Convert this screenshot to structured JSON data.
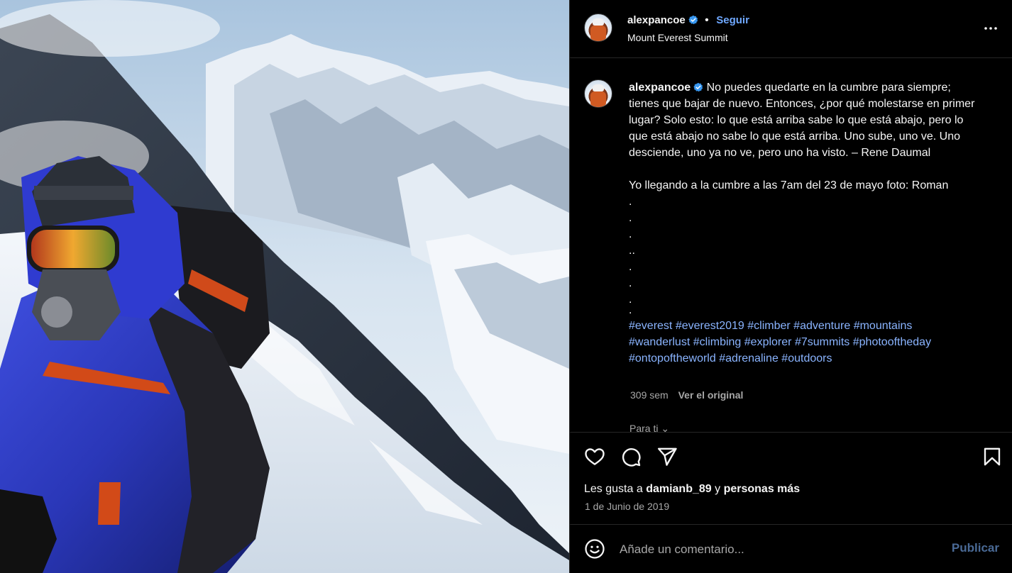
{
  "post": {
    "photo_alt": "Climber on Mount Everest summit ridge",
    "account": {
      "username": "alexpancoe",
      "verified": true,
      "follow_label": "Seguir",
      "location": "Mount Everest Summit"
    },
    "caption": {
      "username": "alexpancoe",
      "text_lines": [
        "No puedes quedarte en la cumbre para siempre;",
        "tienes que bajar de nuevo. Entonces, ¿por qué molestarse en primer",
        "lugar? Solo esto: lo que está arriba sabe lo que está abajo, pero lo",
        "que está abajo no sabe lo que está arriba. Uno sube, uno ve. Uno",
        "desciende, uno ya no ve, pero uno ha visto. – Rene Daumal"
      ],
      "second_paragraph": "Yo llegando a la cumbre a las 7am del 23 de mayo foto: Roman",
      "dot_lines": [
        ".",
        ".",
        ".",
        "..",
        ".",
        ".",
        ".",
        "."
      ],
      "hashtags": [
        "#everest",
        "#everest2019",
        "#climber",
        "#adventure",
        "#mountains",
        "#wanderlust",
        "#climbing",
        "#explorer",
        "#7summits",
        "#photooftheday",
        "#ontopoftheworld",
        "#adrenaline",
        "#outdoors"
      ],
      "age": "309 sem",
      "see_original": "Ver el original",
      "for_you": "Para ti"
    },
    "actions": {
      "likes_prefix": "Les gusta a",
      "liker": "damianb_89",
      "likes_joiner": "y",
      "likes_suffix": "personas más",
      "date": "1 de Junio de 2019"
    },
    "comment": {
      "placeholder": "Añade un comentario...",
      "publish_label": "Publicar"
    }
  },
  "colors": {
    "background": "#000000",
    "link_blue": "#8ab4ff",
    "follow_blue": "#6fa8ff",
    "muted": "#a8a8a8",
    "publish_disabled": "#4a6a96",
    "verified_blue": "#3897f0"
  },
  "icons": {
    "like": "heart-icon",
    "comment": "comment-bubble-icon",
    "share": "paper-plane-icon",
    "save": "bookmark-icon",
    "more": "ellipsis-icon",
    "emoji": "smiley-icon",
    "verified": "verified-badge-icon"
  }
}
